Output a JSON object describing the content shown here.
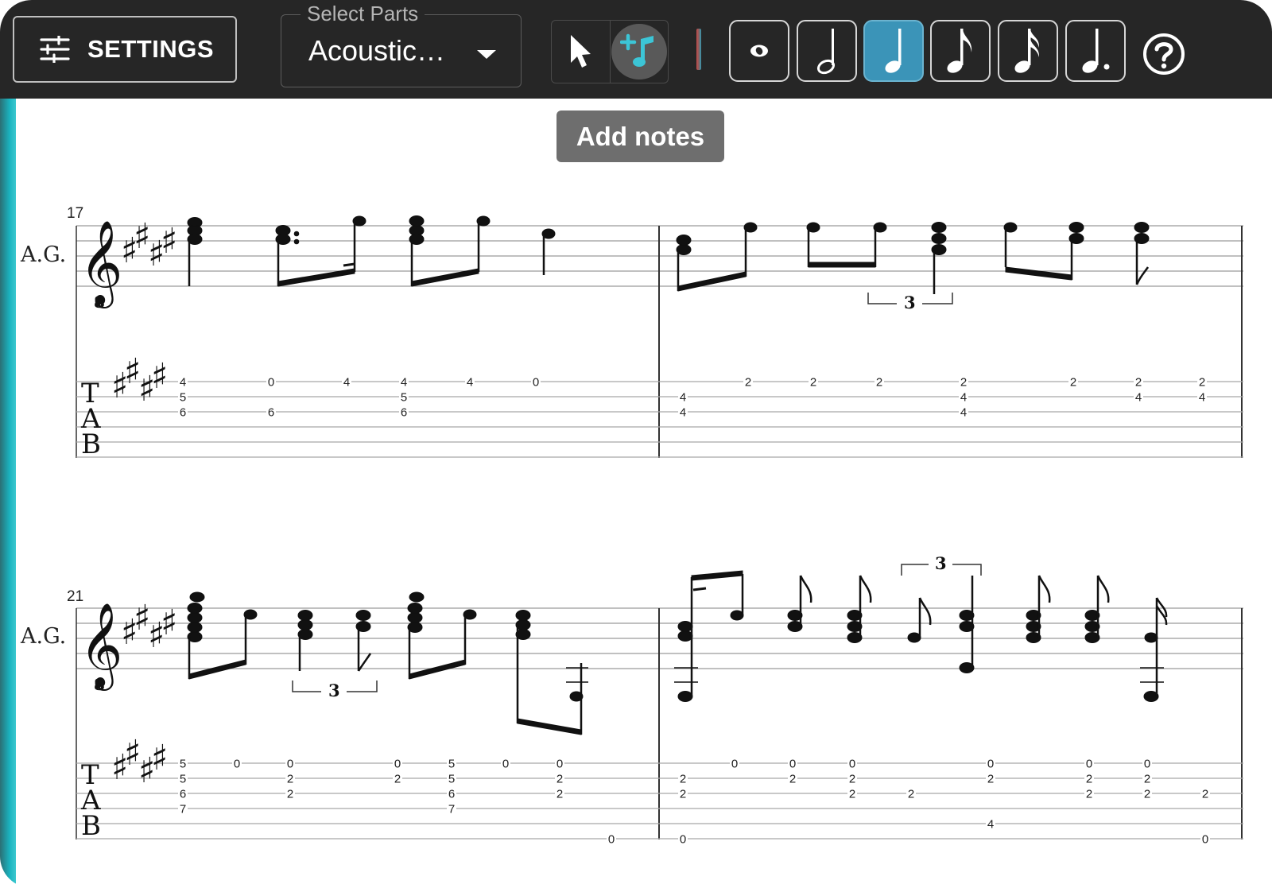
{
  "toolbar": {
    "settings_label": "SETTINGS",
    "parts_legend": "Select Parts",
    "parts_value": "Acoustic…",
    "tooltip": "Add notes",
    "accent_color": "#3b94b8"
  },
  "durations": [
    {
      "name": "whole-note-icon",
      "active": false
    },
    {
      "name": "half-note-icon",
      "active": false
    },
    {
      "name": "quarter-note-icon",
      "active": true
    },
    {
      "name": "eighth-note-icon",
      "active": false
    },
    {
      "name": "sixteenth-note-icon",
      "active": false
    },
    {
      "name": "dotted-note-icon",
      "active": false
    }
  ],
  "score": {
    "systems": [
      {
        "measure_number": "17",
        "instrument": "A.G.",
        "tab_columns": [
          {
            "strings": {
              "1": "4",
              "2": "5",
              "3": "6"
            }
          },
          {
            "strings": {
              "1": "0",
              "3": "6"
            }
          },
          {
            "strings": {
              "1": "4"
            }
          },
          {
            "strings": {
              "1": "4",
              "2": "5",
              "3": "6"
            }
          },
          {
            "strings": {
              "1": "4"
            }
          },
          {
            "strings": {
              "1": "0"
            }
          },
          {
            "strings": {
              "2": "4",
              "3": "4"
            }
          },
          {
            "strings": {
              "1": "2"
            }
          },
          {
            "strings": {
              "1": "2"
            }
          },
          {
            "strings": {
              "1": "2"
            }
          },
          {
            "strings": {
              "1": "2",
              "2": "4",
              "3": "4"
            }
          },
          {
            "strings": {
              "1": "2"
            }
          },
          {
            "strings": {
              "1": "2",
              "2": "4"
            }
          },
          {
            "strings": {
              "1": "2",
              "2": "4"
            }
          }
        ],
        "tuplets": [
          "3"
        ]
      },
      {
        "measure_number": "21",
        "instrument": "A.G.",
        "tab_columns": [
          {
            "strings": {
              "1": "5",
              "2": "5",
              "3": "6",
              "4": "7"
            }
          },
          {
            "strings": {
              "1": "0"
            }
          },
          {
            "strings": {
              "1": "0",
              "2": "2",
              "3": "2"
            }
          },
          {
            "strings": {
              "1": "0",
              "2": "2"
            }
          },
          {
            "strings": {
              "1": "5",
              "2": "5",
              "3": "6",
              "4": "7"
            }
          },
          {
            "strings": {
              "1": "0"
            }
          },
          {
            "strings": {
              "1": "0",
              "2": "2",
              "3": "2"
            }
          },
          {
            "strings": {
              "6": "0"
            }
          },
          {
            "strings": {
              "2": "2",
              "3": "2",
              "6": "0"
            }
          },
          {
            "strings": {
              "1": "0"
            }
          },
          {
            "strings": {
              "1": "0",
              "2": "2"
            }
          },
          {
            "strings": {
              "1": "0",
              "2": "2",
              "3": "2"
            }
          },
          {
            "strings": {
              "3": "2"
            }
          },
          {
            "strings": {
              "1": "0",
              "2": "2",
              "5": "4"
            }
          },
          {
            "strings": {
              "1": "0",
              "2": "2",
              "3": "2"
            }
          },
          {
            "strings": {
              "1": "0",
              "2": "2",
              "3": "2"
            }
          },
          {
            "strings": {
              "3": "2",
              "6": "0"
            }
          }
        ],
        "tuplets": [
          "3",
          "3"
        ]
      }
    ]
  }
}
